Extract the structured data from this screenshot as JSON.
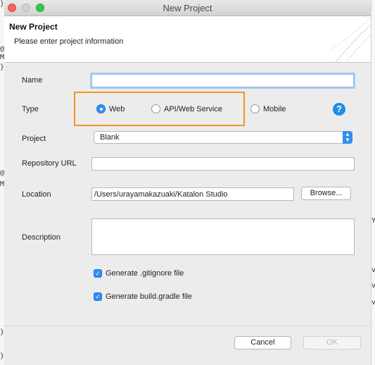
{
  "window": {
    "title": "New Project"
  },
  "banner": {
    "title": "New Project",
    "message": "Please enter project information"
  },
  "form": {
    "name": {
      "label": "Name",
      "value": ""
    },
    "type": {
      "label": "Type",
      "options": [
        {
          "label": "Web",
          "selected": true
        },
        {
          "label": "API/Web Service",
          "selected": false
        },
        {
          "label": "Mobile",
          "selected": false
        }
      ],
      "help": "?"
    },
    "project": {
      "label": "Project",
      "value": "Blank"
    },
    "repository_url": {
      "label": "Repository URL",
      "value": ""
    },
    "location": {
      "label": "Location",
      "value": "/Users/urayamakazuaki/Katalon Studio",
      "browse_label": "Browse..."
    },
    "description": {
      "label": "Description",
      "value": ""
    },
    "gitignore": {
      "label": "Generate .gitignore file",
      "checked": true
    },
    "gradle": {
      "label": "Generate build.gradle file",
      "checked": true
    }
  },
  "footer": {
    "cancel_label": "Cancel",
    "ok_label": "OK"
  },
  "colors": {
    "accent": "#2f8ef4",
    "highlight_box": "#f29423",
    "help": "#1b8ee8"
  },
  "edge_glyphs": {
    "left": [
      "}",
      "@",
      "M",
      "}",
      "@",
      "M",
      "}",
      "}"
    ],
    "right": [
      "Y",
      "v",
      "v",
      "v"
    ]
  }
}
